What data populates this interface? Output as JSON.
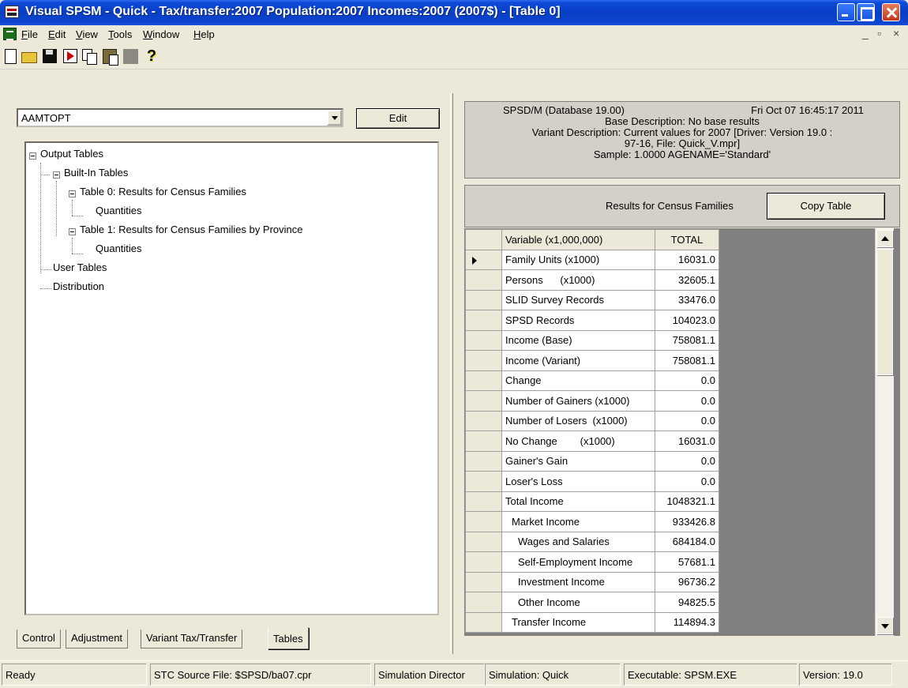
{
  "window": {
    "title": "Visual SPSM - Quick - Tax/transfer:2007 Population:2007 Incomes:2007 (2007$) - [Table 0]"
  },
  "menu": [
    "File",
    "Edit",
    "View",
    "Tools",
    "Window",
    "Help"
  ],
  "toolbar": {
    "icons": [
      "new-icon",
      "open-icon",
      "save-icon",
      "run-icon",
      "copy-icon",
      "paste-icon",
      "blank-icon",
      "help-icon"
    ],
    "help_glyph": "?"
  },
  "left": {
    "combo_value": "AAMTOPT",
    "edit_label": "Edit",
    "tree": {
      "output_tables": "Output Tables",
      "built_in": "Built-In Tables",
      "table0": "Table 0: Results for Census Families",
      "table0_child": "Quantities",
      "table1": "Table 1: Results for Census Families by Province",
      "table1_child": "Quantities",
      "user_tables": "User Tables",
      "distribution": "Distribution"
    },
    "tabs": [
      "Control",
      "Adjustment",
      "Variant Tax/Transfer",
      "Tables"
    ]
  },
  "info": {
    "line1_left": "SPSD/M (Database 19.00)",
    "line1_right": "Fri Oct 07 16:45:17 2011",
    "line2": "Base Description: No base results",
    "line3": "Variant Description: Current values for 2007      [Driver: Version 19.0 :",
    "line4": "97-16, File: Quick_V.mpr]",
    "line5": "Sample: 1.0000  AGENAME='Standard'"
  },
  "results": {
    "title": "Results for Census Families",
    "copy_label": "Copy Table"
  },
  "grid": {
    "col_variable": "Variable  (x1,000,000)",
    "col_total": "TOTAL",
    "rows": [
      {
        "label": "Family Units (x1000)",
        "value": "16031.0"
      },
      {
        "label": "Persons      (x1000)",
        "value": "32605.1"
      },
      {
        "label": "SLID Survey Records",
        "value": "33476.0"
      },
      {
        "label": "SPSD Records",
        "value": "104023.0"
      },
      {
        "label": "Income (Base)",
        "value": "758081.1"
      },
      {
        "label": "Income (Variant)",
        "value": "758081.1"
      },
      {
        "label": "Change",
        "value": "0.0"
      },
      {
        "label": "Number of Gainers (x1000)",
        "value": "0.0"
      },
      {
        "label": "Number of Losers  (x1000)",
        "value": "0.0"
      },
      {
        "label": "No Change        (x1000)",
        "value": "16031.0"
      },
      {
        "label": "Gainer's Gain",
        "value": "0.0"
      },
      {
        "label": "Loser's Loss",
        "value": "0.0"
      },
      {
        "label": "Total Income",
        "value": "1048321.1"
      },
      {
        "label": "Market Income",
        "value": "933426.8"
      },
      {
        "label": "Wages and Salaries",
        "value": "684184.0"
      },
      {
        "label": "Self-Employment Income",
        "value": "57681.1"
      },
      {
        "label": "Investment Income",
        "value": "96736.2"
      },
      {
        "label": "Other Income",
        "value": "94825.5"
      },
      {
        "label": "Transfer Income",
        "value": "114894.3"
      }
    ]
  },
  "status": {
    "ready": "Ready",
    "source": "STC Source File: $SPSD/ba07.cpr",
    "director": "Simulation Director",
    "simulation": "Simulation: Quick",
    "executable": "Executable: SPSM.EXE",
    "version": "Version: 19.0"
  }
}
